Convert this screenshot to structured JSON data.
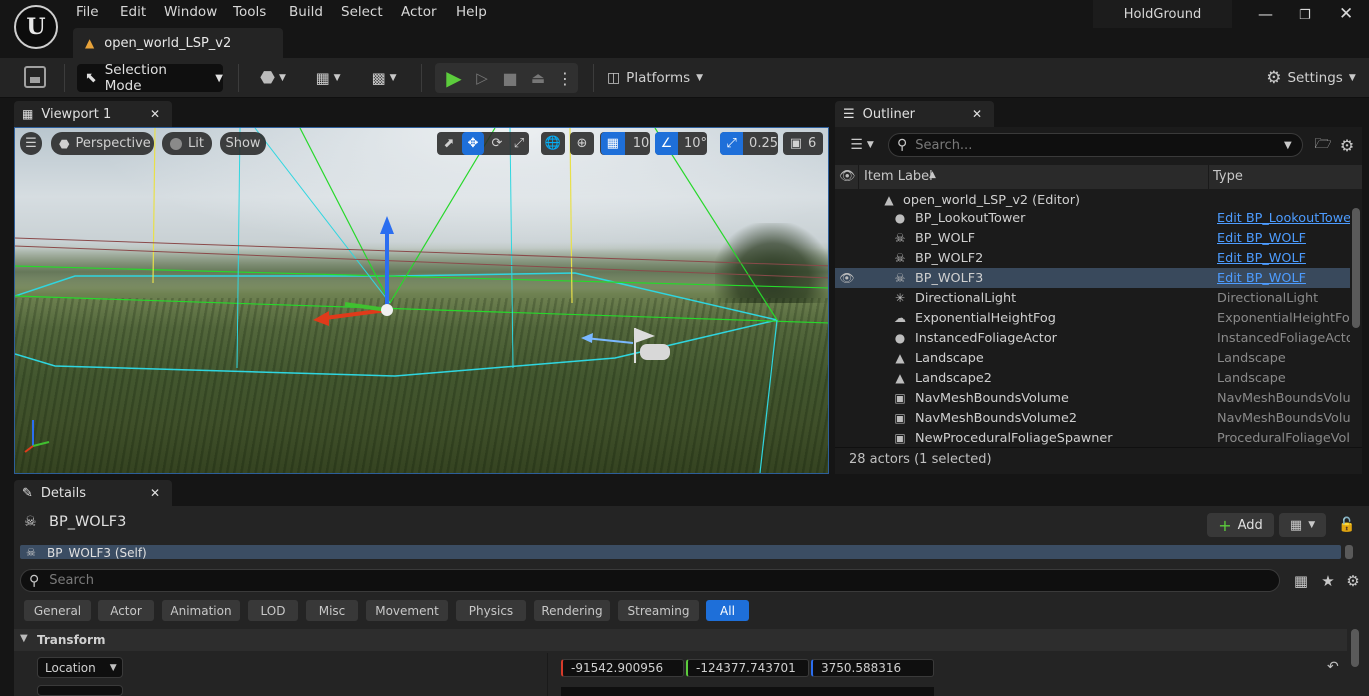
{
  "app": {
    "logo": "U",
    "project_name": "HoldGround"
  },
  "menu": [
    "File",
    "Edit",
    "Window",
    "Tools",
    "Build",
    "Select",
    "Actor",
    "Help"
  ],
  "level_tab": "open_world_LSP_v2",
  "toolbar": {
    "selection_mode": "Selection Mode",
    "platforms": "Platforms",
    "settings": "Settings"
  },
  "viewport": {
    "tab": "Viewport 1",
    "view_mode": "Perspective",
    "lighting": "Lit",
    "show": "Show",
    "grid_snap": "10",
    "rotation_snap": "10°",
    "scale_snap": "0.25",
    "camera_speed": "6"
  },
  "outliner": {
    "tab": "Outliner",
    "search_placeholder": "Search...",
    "col_label": "Item Label",
    "col_type": "Type",
    "root": "open_world_LSP_v2 (Editor)",
    "rows": [
      {
        "label": "BP_LookoutTower",
        "type": "Edit BP_LookoutTower",
        "link": true,
        "icon": "sphere-icon"
      },
      {
        "label": "BP_WOLF",
        "type": "Edit BP_WOLF",
        "link": true,
        "icon": "skull-icon"
      },
      {
        "label": "BP_WOLF2",
        "type": "Edit BP_WOLF",
        "link": true,
        "icon": "skull-icon"
      },
      {
        "label": "BP_WOLF3",
        "type": "Edit BP_WOLF",
        "link": true,
        "icon": "skull-icon",
        "selected": true
      },
      {
        "label": "DirectionalLight",
        "type": "DirectionalLight",
        "link": false,
        "icon": "sun-icon"
      },
      {
        "label": "ExponentialHeightFog",
        "type": "ExponentialHeightFog",
        "link": false,
        "icon": "cloud-icon"
      },
      {
        "label": "InstancedFoliageActor",
        "type": "InstancedFoliageActor",
        "link": false,
        "icon": "sphere-icon"
      },
      {
        "label": "Landscape",
        "type": "Landscape",
        "link": false,
        "icon": "mountain-icon"
      },
      {
        "label": "Landscape2",
        "type": "Landscape",
        "link": false,
        "icon": "mountain-icon"
      },
      {
        "label": "NavMeshBoundsVolume",
        "type": "NavMeshBoundsVolume",
        "link": false,
        "icon": "cube-icon"
      },
      {
        "label": "NavMeshBoundsVolume2",
        "type": "NavMeshBoundsVolume",
        "link": false,
        "icon": "cube-icon"
      },
      {
        "label": "NewProceduralFoliageSpawner",
        "type": "ProceduralFoliageVolume",
        "link": false,
        "icon": "cube-icon"
      }
    ],
    "footer": "28 actors (1 selected)"
  },
  "details": {
    "tab": "Details",
    "actor_name": "BP_WOLF3",
    "add_label": "Add",
    "component_self": "BP_WOLF3 (Self)",
    "search_placeholder": "Search",
    "filters": [
      "General",
      "Actor",
      "Animation",
      "LOD",
      "Misc",
      "Movement",
      "Physics",
      "Rendering",
      "Streaming",
      "All"
    ],
    "active_filter": "All",
    "section": "Transform",
    "location_label": "Location",
    "location": {
      "x": "-91542.900956",
      "y": "-124377.743701",
      "z": "3750.588316"
    }
  },
  "colors": {
    "accent": "#1e6fd9",
    "link": "#4d9cff",
    "selected_row": "#39495c"
  }
}
